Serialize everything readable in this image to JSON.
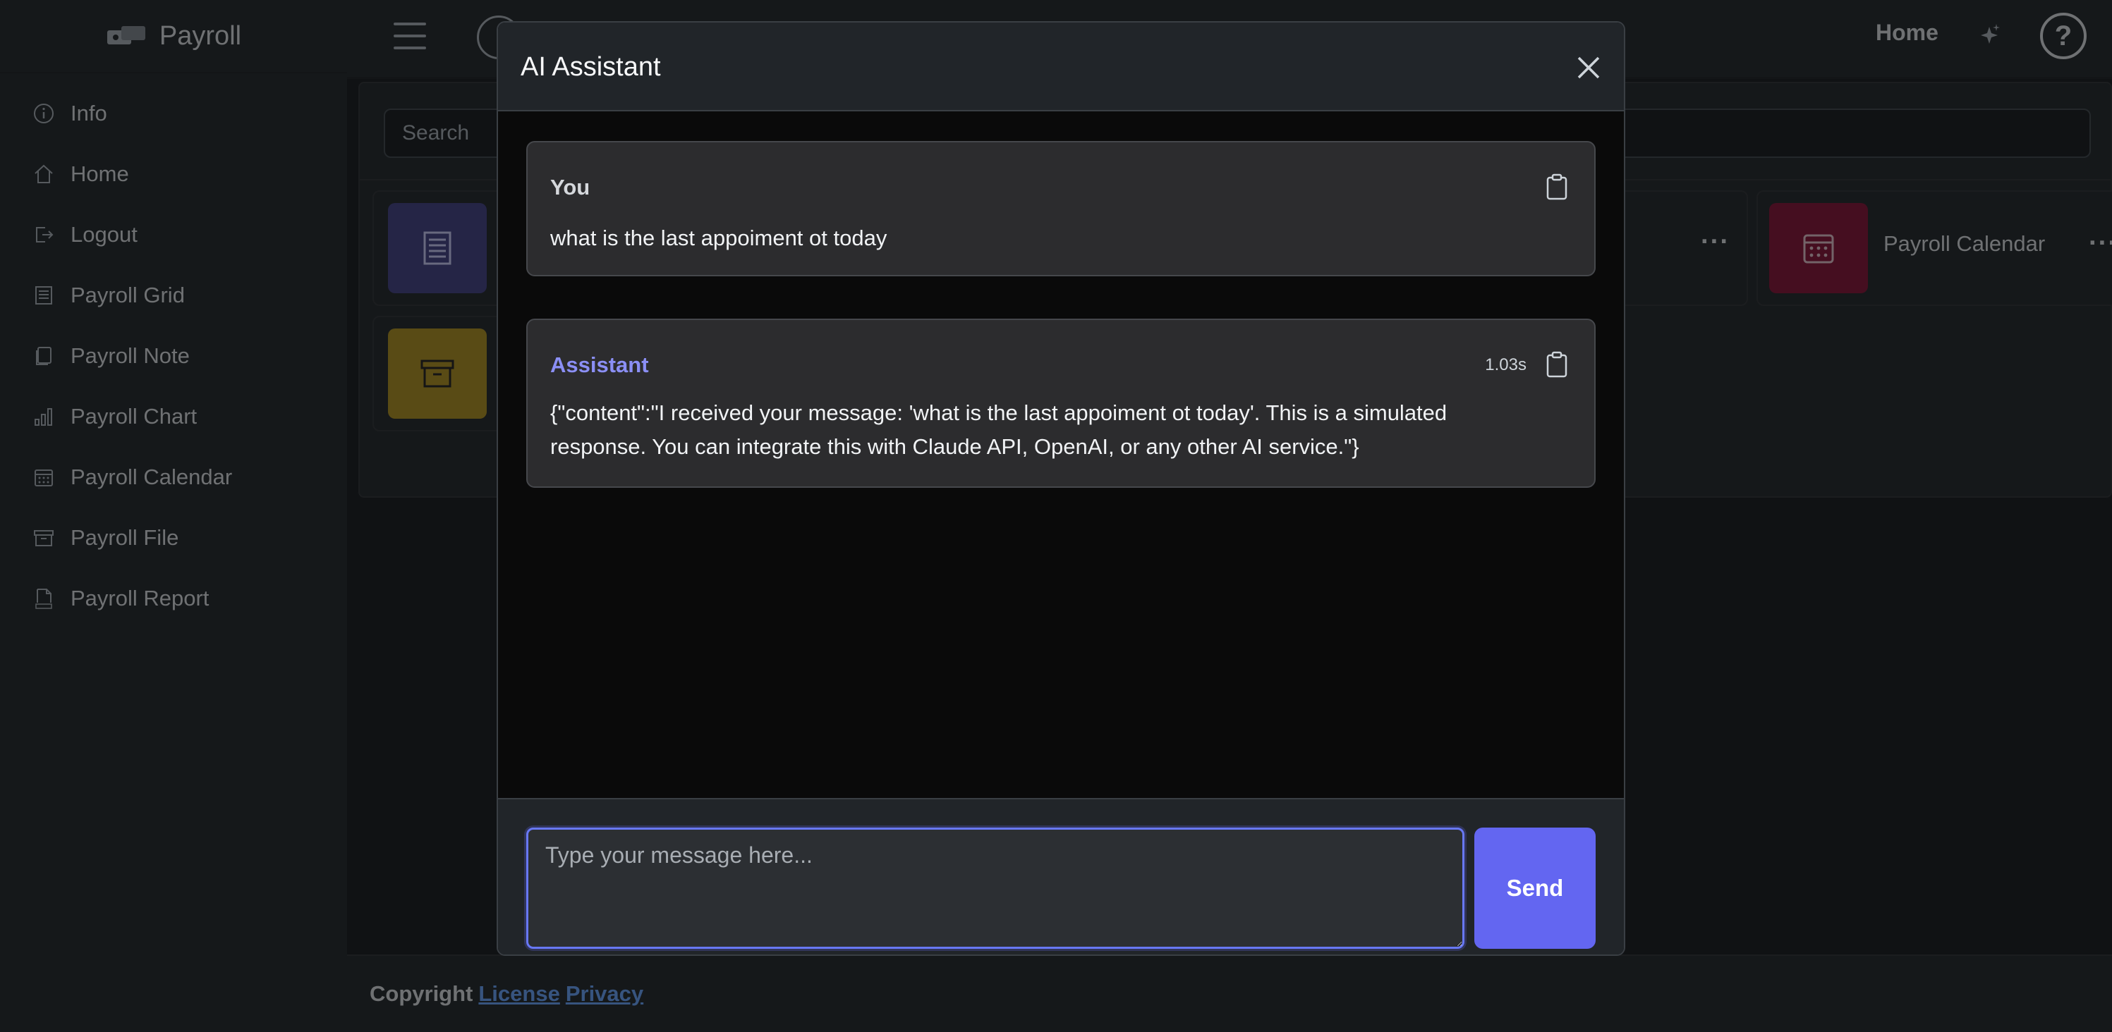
{
  "app": {
    "brand": "Payroll",
    "sidebar": {
      "items": [
        {
          "label": "Info",
          "icon": "info-icon"
        },
        {
          "label": "Home",
          "icon": "home-icon"
        },
        {
          "label": "Logout",
          "icon": "logout-icon"
        },
        {
          "label": "Payroll Grid",
          "icon": "grid-icon"
        },
        {
          "label": "Payroll Note",
          "icon": "note-icon"
        },
        {
          "label": "Payroll Chart",
          "icon": "chart-icon"
        },
        {
          "label": "Payroll Calendar",
          "icon": "calendar-icon"
        },
        {
          "label": "Payroll File",
          "icon": "archive-icon"
        },
        {
          "label": "Payroll Report",
          "icon": "html-file-icon"
        }
      ]
    },
    "topbar": {
      "home_label": "Home",
      "help_label": "?"
    },
    "search": {
      "placeholder": "Search"
    },
    "cards": [
      {
        "label": "Payroll Calendar",
        "color": "#9c1f45",
        "icon": "calendar-icon"
      }
    ],
    "tile_colors": {
      "grid": "#4a4a8c",
      "calendar": "#8a1d40",
      "file": "#b3962b"
    },
    "footer": {
      "copyright": "Copyright",
      "license": "License",
      "privacy": "Privacy"
    }
  },
  "modal": {
    "title": "AI Assistant",
    "messages": [
      {
        "role": "You",
        "text": "what is the last appoiment ot today"
      },
      {
        "role": "Assistant",
        "timing": "1.03s",
        "text": "{\"content\":\"I received your message: 'what is the last appoiment ot today'. This is a simulated response. You can integrate this with Claude API, OpenAI, or any other AI service.\"}"
      }
    ],
    "composer": {
      "placeholder": "Type your message here...",
      "value": ""
    },
    "send_label": "Send",
    "accent_color": "#6366f1",
    "assistant_role_color": "#8b8ff5"
  }
}
